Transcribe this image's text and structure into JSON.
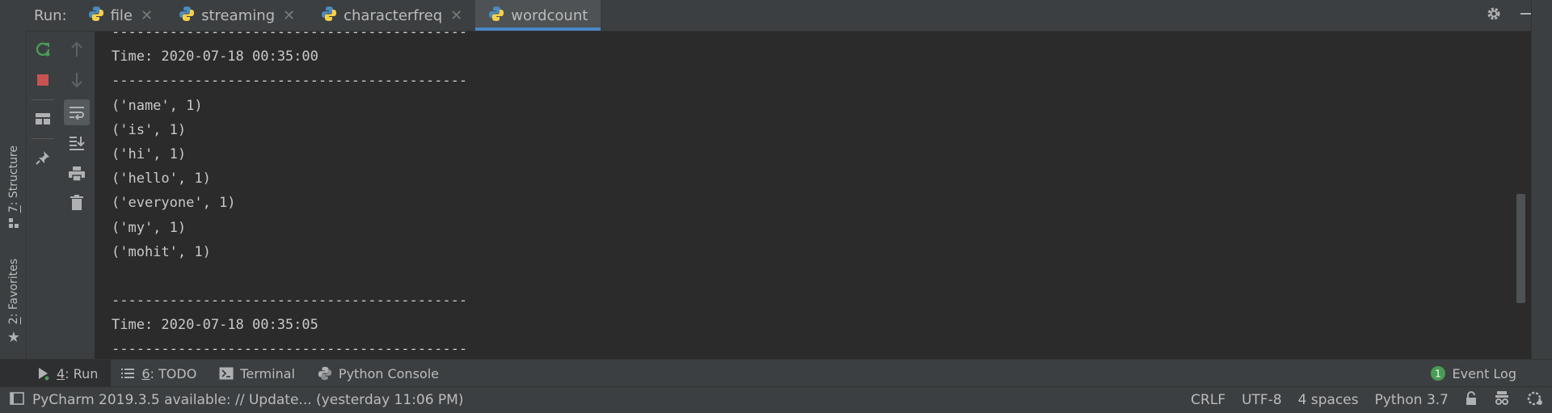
{
  "run_panel": {
    "label": "Run:",
    "tabs": [
      {
        "label": "file"
      },
      {
        "label": "streaming"
      },
      {
        "label": "characterfreq"
      },
      {
        "label": "wordcount",
        "active": true
      }
    ]
  },
  "side_tabs": {
    "structure": {
      "num": "7",
      "label": ": Structure"
    },
    "favorites": {
      "num": "2",
      "label": ": Favorites"
    }
  },
  "console": {
    "lines": [
      "-------------------------------------------",
      "Time: 2020-07-18 00:35:00",
      "-------------------------------------------",
      "('name', 1)",
      "('is', 1)",
      "('hi', 1)",
      "('hello', 1)",
      "('everyone', 1)",
      "('my', 1)",
      "('mohit', 1)",
      "",
      "-------------------------------------------",
      "Time: 2020-07-18 00:35:05",
      "-------------------------------------------"
    ]
  },
  "tool_windows": {
    "run": {
      "num": "4",
      "label": ": Run"
    },
    "todo": {
      "num": "6",
      "label": ": TODO"
    },
    "terminal": {
      "label": "Terminal"
    },
    "python_console": {
      "label": "Python Console"
    },
    "event_log": {
      "label": "Event Log",
      "count": "1"
    }
  },
  "status_bar": {
    "message": "PyCharm 2019.3.5 available: // Update... (yesterday 11:06 PM)",
    "line_sep": "CRLF",
    "encoding": "UTF-8",
    "indent": "4 spaces",
    "interpreter": "Python 3.7"
  },
  "colors": {
    "accent": "#4a88c7",
    "rerun_green": "#499c54",
    "stop_red": "#c75450",
    "event_badge": "#499c54"
  }
}
